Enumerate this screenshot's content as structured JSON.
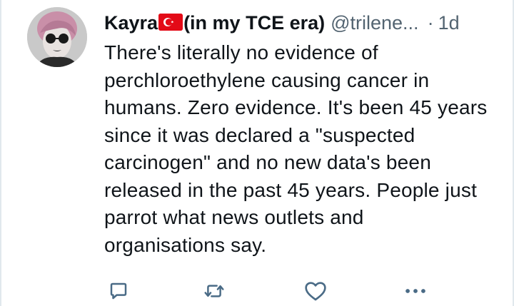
{
  "tweet": {
    "display_name": "Kayra",
    "flag_icon": "turkey-flag-icon",
    "name_suffix": "(in my TCE era)",
    "handle": "@trilene...",
    "separator": "·",
    "time": "1d",
    "body": "There's literally no evidence of perchloroethylene causing cancer in humans. Zero evidence. It's been 45 years since it was declared a \"suspected carcinogen\" and no new data's been released in the past 45 years. People just parrot what news outlets and organisations say."
  },
  "actions": {
    "reply_icon": "reply-icon",
    "retweet_icon": "retweet-icon",
    "like_icon": "heart-icon",
    "more_icon": "more-icon"
  },
  "colors": {
    "text": "#0f1419",
    "secondary": "#536471",
    "icon": "#4a6b86",
    "flag_red": "#e30a17"
  }
}
